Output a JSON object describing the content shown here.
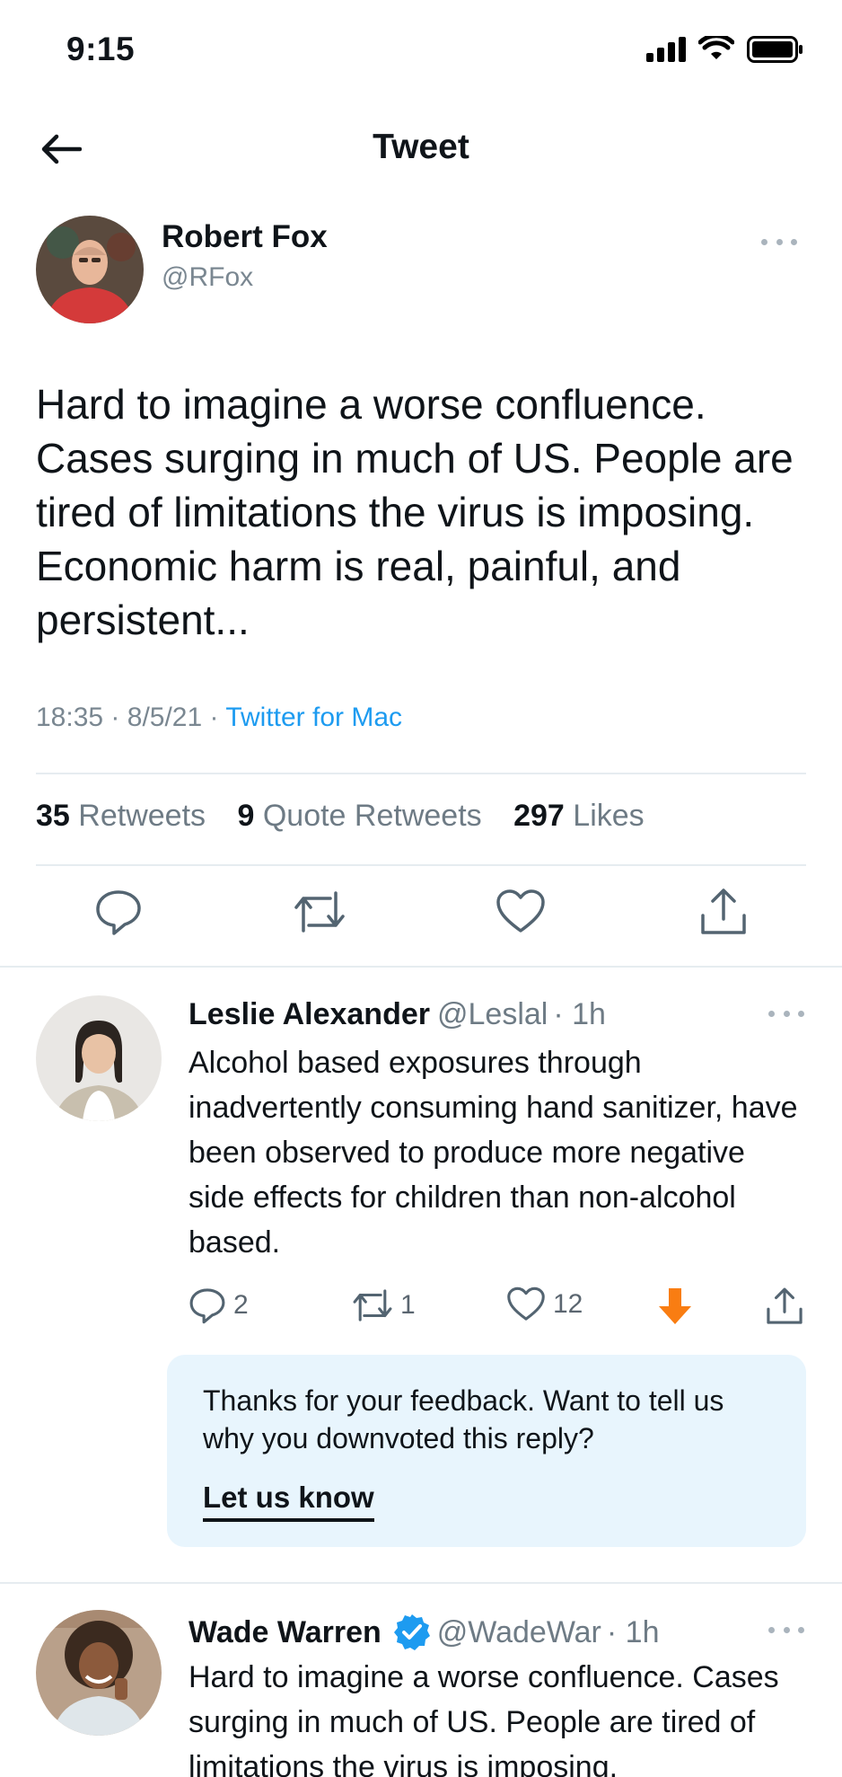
{
  "status_bar": {
    "time": "9:15"
  },
  "nav": {
    "title": "Tweet"
  },
  "main_tweet": {
    "author_name": "Robert Fox",
    "author_handle": "@RFox",
    "text": "Hard to imagine a worse confluence. Cases surging in much of US. People are tired of limitations the virus is imposing. Economic harm is real, painful, and persistent...",
    "time": "18:35",
    "date": "8/5/21",
    "separator": "·",
    "source": "Twitter for Mac",
    "stats": {
      "retweets_count": "35",
      "retweets_label": "Retweets",
      "quotes_count": "9",
      "quotes_label": "Quote Retweets",
      "likes_count": "297",
      "likes_label": "Likes"
    }
  },
  "replies": [
    {
      "author_name": "Leslie Alexander",
      "author_handle": "@Leslal",
      "time": "· 1h",
      "text": "Alcohol based exposures through inadvertently consuming hand sanitizer, have been observed to produce more negative side effects for children than non-alcohol based.",
      "reply_count": "2",
      "retweet_count": "1",
      "like_count": "12",
      "downvote_color": "#f97d12"
    },
    {
      "author_name": "Wade Warren",
      "author_handle": "@WadeWar",
      "time": "· 1h",
      "verified": true,
      "text": "Hard to imagine a worse confluence. Cases surging in much of US. People are tired of limitations the virus is imposing."
    }
  ],
  "feedback": {
    "message": "Thanks for your feedback. Want to tell us why you downvoted this reply?",
    "link_label": "Let us know"
  },
  "colors": {
    "accent": "#1d9bf0",
    "feedback_bg": "#e8f5fd",
    "muted": "#6e7b85"
  }
}
